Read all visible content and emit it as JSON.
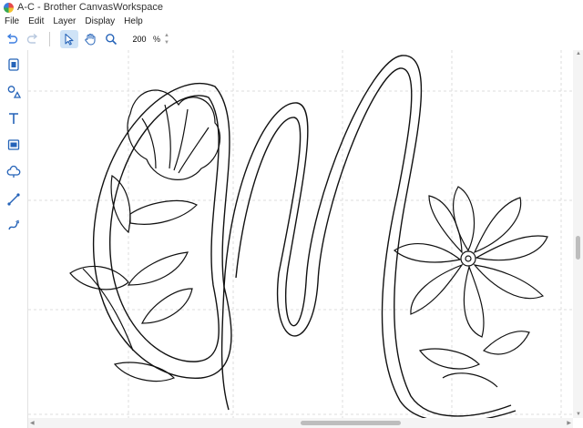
{
  "window": {
    "title": "A-C - Brother CanvasWorkspace"
  },
  "menu": [
    "File",
    "Edit",
    "Layer",
    "Display",
    "Help"
  ],
  "toolbar": {
    "zoom_value": "200",
    "zoom_unit": "%"
  },
  "colors": {
    "accent": "#3b7de0",
    "selected_bg": "#cfe3f7",
    "grid": "#dddddd",
    "artwork_stroke": "#111111"
  },
  "icons": {
    "undo": "undo-icon",
    "redo": "redo-icon",
    "select": "select-pointer-icon",
    "hand": "hand-pan-icon",
    "zoom": "magnifier-icon",
    "sidebar": [
      "object-edit-icon",
      "shapes-icon",
      "text-icon",
      "image-trace-icon",
      "auto-fill-pattern-icon",
      "line-tool-icon",
      "freehand-tool-icon"
    ]
  }
}
